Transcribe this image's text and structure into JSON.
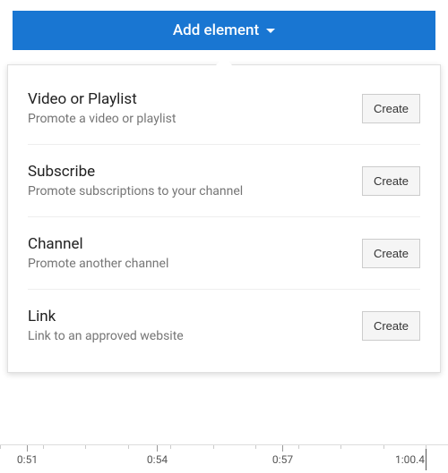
{
  "button": {
    "label": "Add element"
  },
  "items": [
    {
      "title": "Video or Playlist",
      "desc": "Promote a video or playlist",
      "action": "Create"
    },
    {
      "title": "Subscribe",
      "desc": "Promote subscriptions to your channel",
      "action": "Create"
    },
    {
      "title": "Channel",
      "desc": "Promote another channel",
      "action": "Create"
    },
    {
      "title": "Link",
      "desc": "Link to an approved website",
      "action": "Create"
    }
  ],
  "timeline": {
    "ticks": [
      {
        "label": "0:51",
        "pos": 6
      },
      {
        "label": "0:54",
        "pos": 35
      },
      {
        "label": "0:57",
        "pos": 63
      },
      {
        "label": "1:00.4",
        "pos": 95,
        "end": true
      }
    ]
  }
}
